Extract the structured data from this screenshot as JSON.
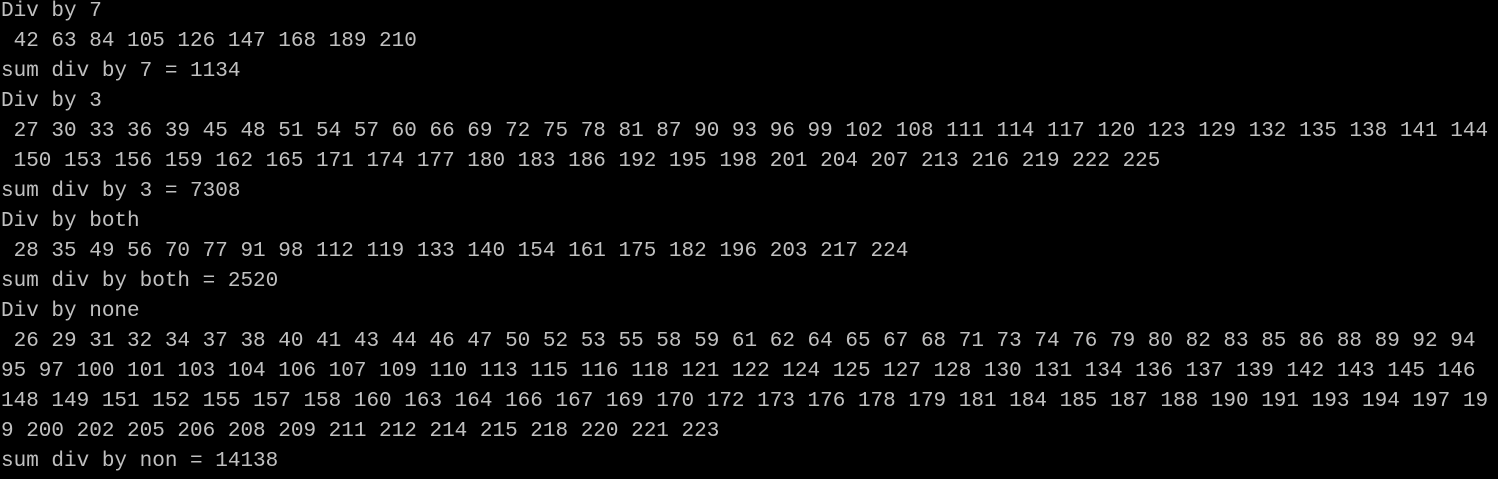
{
  "console": {
    "lines": [
      "Div by 7",
      " 42 63 84 105 126 147 168 189 210",
      "sum div by 7 = 1134",
      "Div by 3",
      " 27 30 33 36 39 45 48 51 54 57 60 66 69 72 75 78 81 87 90 93 96 99 102 108 111 114 117 120 123 129 132 135 138 141 144",
      " 150 153 156 159 162 165 171 174 177 180 183 186 192 195 198 201 204 207 213 216 219 222 225",
      "sum div by 3 = 7308",
      "Div by both",
      " 28 35 49 56 70 77 91 98 112 119 133 140 154 161 175 182 196 203 217 224",
      "sum div by both = 2520",
      "Div by none",
      " 26 29 31 32 34 37 38 40 41 43 44 46 47 50 52 53 55 58 59 61 62 64 65 67 68 71 73 74 76 79 80 82 83 85 86 88 89 92 94",
      "95 97 100 101 103 104 106 107 109 110 113 115 116 118 121 122 124 125 127 128 130 131 134 136 137 139 142 143 145 146",
      "148 149 151 152 155 157 158 160 163 164 166 167 169 170 172 173 176 178 179 181 184 185 187 188 190 191 193 194 197 19",
      "9 200 202 205 206 208 209 211 212 214 215 218 220 221 223",
      "sum div by non = 14138"
    ]
  }
}
